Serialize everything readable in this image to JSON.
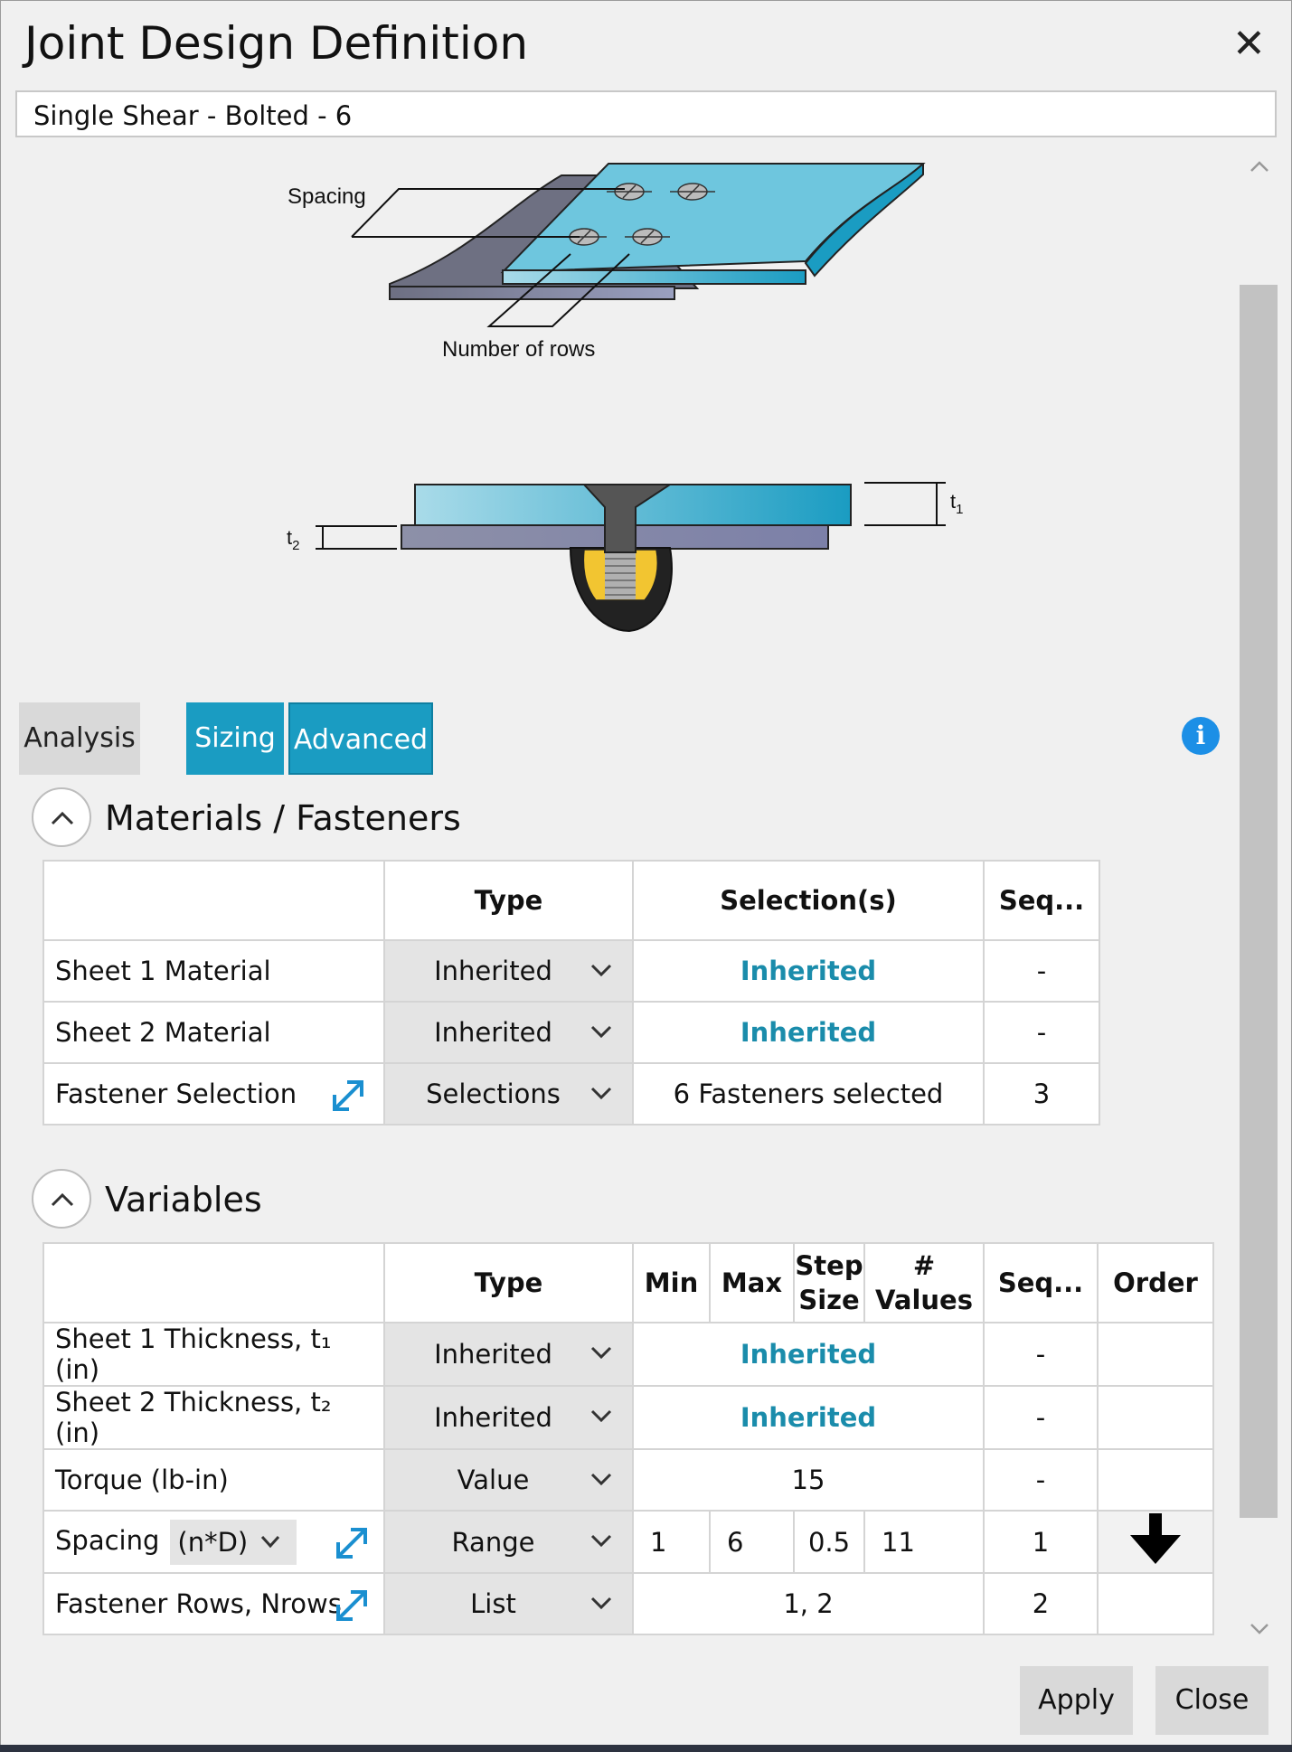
{
  "window": {
    "title": "Joint Design Definition",
    "close_symbol": "✕"
  },
  "joint_name": "Single Shear - Bolted - 6",
  "diagram": {
    "spacing_label": "Spacing",
    "rows_label": "Number of rows",
    "t1_label": "t",
    "t1_sub": "1",
    "t2_label": "t",
    "t2_sub": "2"
  },
  "tabs": [
    {
      "label": "Analysis",
      "active": false
    },
    {
      "label": "Sizing",
      "active": true
    },
    {
      "label": "Advanced",
      "active": true
    }
  ],
  "info_icon": "i",
  "materials": {
    "title": "Materials / Fasteners",
    "headers": {
      "type": "Type",
      "selection": "Selection(s)",
      "seq": "Seq..."
    },
    "rows": [
      {
        "label": "Sheet 1 Material",
        "type": "Inherited",
        "selection": "Inherited",
        "seq": "-"
      },
      {
        "label": "Sheet 2 Material",
        "type": "Inherited",
        "selection": "Inherited",
        "seq": "-"
      },
      {
        "label": "Fastener Selection",
        "type": "Selections",
        "selection": "6 Fasteners selected",
        "seq": "3"
      }
    ]
  },
  "variables": {
    "title": "Variables",
    "headers": {
      "type": "Type",
      "min": "Min",
      "max": "Max",
      "step": "Step Size",
      "nvalues": "# Values",
      "seq": "Seq...",
      "order": "Order"
    },
    "rows": [
      {
        "label": "Sheet 1 Thickness, t₁ (in)",
        "type": "Inherited",
        "value": "Inherited",
        "seq": "-"
      },
      {
        "label": "Sheet 2 Thickness, t₂ (in)",
        "type": "Inherited",
        "value": "Inherited",
        "seq": "-"
      },
      {
        "label": "Torque (lb-in)",
        "type": "Value",
        "value": "15",
        "seq": "-"
      },
      {
        "label": "Spacing",
        "unit": "(n*D)",
        "type": "Range",
        "min": "1",
        "max": "6",
        "step": "0.5",
        "nvalues": "11",
        "seq": "1"
      },
      {
        "label": "Fastener Rows, Nrows",
        "type": "List",
        "value": "1, 2",
        "seq": "2"
      }
    ]
  },
  "buttons": {
    "apply": "Apply",
    "close": "Close"
  },
  "colors": {
    "accent": "#1a9cc2",
    "teal_text": "#1a8cab",
    "info_blue": "#1c8fe6"
  }
}
